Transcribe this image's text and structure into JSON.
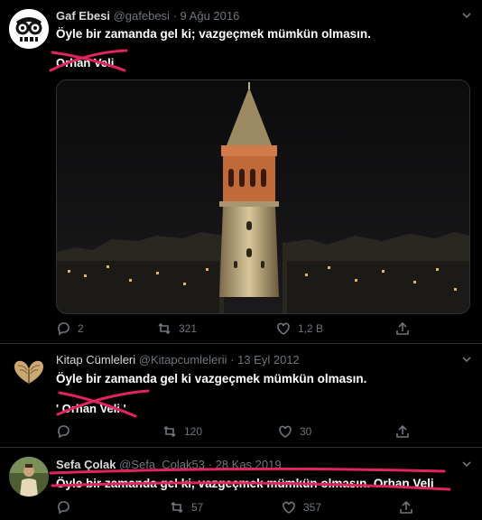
{
  "tweets": [
    {
      "name": "Gaf Ebesi",
      "handle": "@gafebesi",
      "sep": "·",
      "date": "9 Ağu 2016",
      "text": "Öyle bir zamanda gel ki; vazgeçmek mümkün olmasın.",
      "signature": "Orhan Veli",
      "replies": "2",
      "retweets": "321",
      "likes": "1,2 B"
    },
    {
      "name": "Kitap Cümleleri",
      "handle": "@Kitapcumlelerii",
      "sep": "·",
      "date": "13 Eyl 2012",
      "text": "Öyle bir zamanda gel ki vazgeçmek mümkün olmasın.",
      "signature_prefix": "' ",
      "signature": "Orhan Veli",
      "signature_suffix": " '",
      "retweets": "120",
      "likes": "30"
    },
    {
      "name": "Sefa Çolak",
      "handle": "@Sefa_Colak53",
      "sep": "·",
      "date": "28 Kas 2019",
      "text": "Öyle bir zamanda gel ki, vazgeçmek mümkün olmasın. Orhan Veli",
      "retweets": "57",
      "likes": "357"
    }
  ],
  "colors": {
    "bg": "#000000",
    "muted": "#6e767d",
    "strike": "#e0245e",
    "moon": "#e07a1a"
  }
}
